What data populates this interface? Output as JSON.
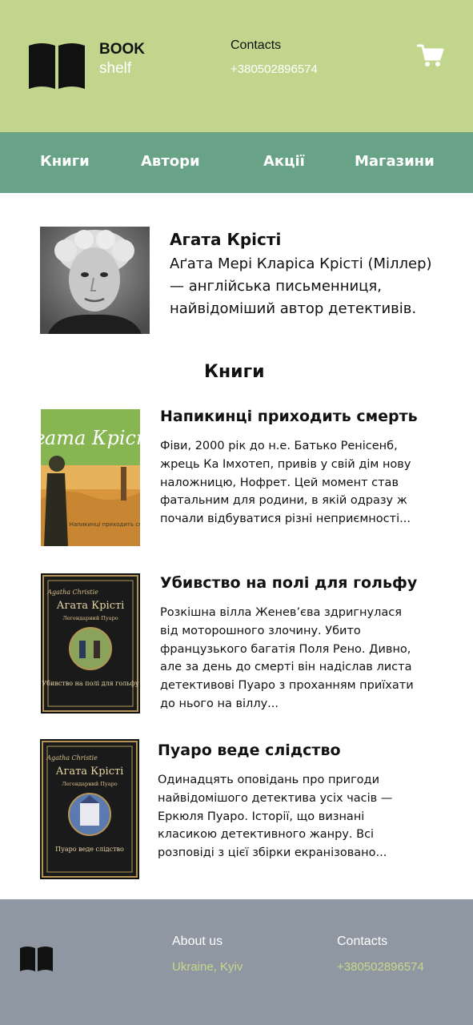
{
  "header": {
    "logo_word1": "BOOK",
    "logo_word2": "shelf",
    "contacts_label": "Contacts",
    "phone": "+380502896574",
    "cart_icon": "cart-icon"
  },
  "nav": {
    "items": [
      {
        "label": "Книги"
      },
      {
        "label": "Автори"
      },
      {
        "label": "Акції"
      },
      {
        "label": "Магазини"
      }
    ]
  },
  "author": {
    "name": "Агата Крісті",
    "bio": "Аґата Мері Кларіса Крісті (Міллер) — англійська письменниця, найвідоміший автор детективів."
  },
  "books_heading": "Книги",
  "books": [
    {
      "title": "Напикинці приходить смерть",
      "description": "Фіви, 2000 рік до н.е. Батько Ренісенб, жрець Ка Імхотеп, привів у свій дім нову наложницю, Нофрет. Цей момент став фатальним для родини, в якій одразу ж почали відбуватися різні неприємності...",
      "cover": {
        "author": "Агата Крісті",
        "title": "Напикинці приходить смерть"
      }
    },
    {
      "title": "Убивство на полі для гольфу",
      "description": "Розкішна вілла Женев’єва здригнулася від моторошного злочину. Убито французького багатія Поля Рено. Дивно, але за день до смерті він надіслав листа детективові Пуаро з проханням приїхати до нього на віллу...",
      "cover": {
        "signature": "Agatha Christie",
        "author": "Агата Крісті",
        "series": "Легендарний Пуаро",
        "title": "Убивство на полі для гольфу"
      }
    },
    {
      "title": "Пуаро веде слідство",
      "description": "Одинадцять оповідань про пригоди найвідомішого детектива усіх часів — Еркюля Пуаро. Історії, що визнані класикою детективного жанру. Всі розповіді з цієї збірки екранізовано...",
      "cover": {
        "signature": "Agatha Christie",
        "author": "Агата Крісті",
        "series": "Легендарний Пуаро",
        "title": "Пуаро веде слідство"
      }
    }
  ],
  "footer": {
    "about_label": "About us",
    "city": "Ukraine, Kyiv",
    "contacts_label": "Contacts",
    "phone": "+380502896574"
  },
  "colors": {
    "header_bg": "#c1d68c",
    "nav_bg": "#68a387",
    "footer_bg": "#8f97a3",
    "footer_accent": "#c8d88a"
  }
}
